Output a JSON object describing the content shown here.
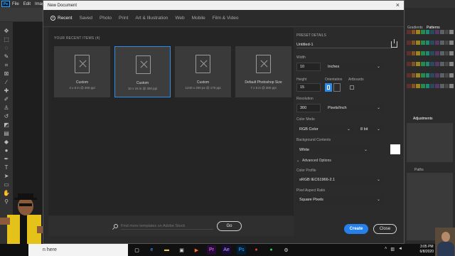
{
  "app": {
    "menu": [
      "File",
      "Edit",
      "Image"
    ],
    "logo": "Ps"
  },
  "right_panel": {
    "tabs": [
      "Gradients",
      "Patterns"
    ],
    "adjustments_label": "Adjustments",
    "layers_label": "Paths"
  },
  "dialog": {
    "title": "New Document",
    "close_glyph": "×",
    "tabs": [
      "Recent",
      "Saved",
      "Photo",
      "Print",
      "Art & Illustration",
      "Web",
      "Mobile",
      "Film & Video"
    ],
    "recent_header": "YOUR RECENT ITEMS  (4)",
    "recent_items": [
      {
        "name": "Custom",
        "desc": "4 x 6 in @ 300 ppi",
        "selected": false
      },
      {
        "name": "Custom",
        "desc": "10 x 15 in @ 300 ppi",
        "selected": true
      },
      {
        "name": "Custom",
        "desc": "1240 x 200 px @ 170 ppi",
        "selected": false
      },
      {
        "name": "Default Photoshop Size",
        "desc": "7 x 5 in @ 300 ppi",
        "selected": false
      }
    ],
    "template_search": {
      "placeholder": "Find more templates on Adobe Stock",
      "go_label": "Go"
    },
    "preset_details": {
      "header": "PRESET DETAILS",
      "name": "Untitled-1",
      "width_label": "Width",
      "width_value": "10",
      "width_unit": "Inches",
      "height_label": "Height",
      "height_value": "15",
      "orientation_label": "Orientation",
      "artboards_label": "Artboards",
      "resolution_label": "Resolution",
      "resolution_value": "300",
      "resolution_unit": "Pixels/Inch",
      "color_mode_label": "Color Mode",
      "color_mode_value": "RGB Color",
      "bit_depth": "8 bit",
      "background_label": "Background Contents",
      "background_value": "White",
      "advanced_label": "Advanced Options",
      "color_profile_label": "Color Profile",
      "color_profile_value": "sRGB IEC61966-2.1",
      "pixel_aspect_label": "Pixel Aspect Ratio",
      "pixel_aspect_value": "Square Pixels"
    },
    "create_label": "Create",
    "close_label": "Close"
  },
  "taskbar": {
    "search_text": "n here",
    "time": "3:05 PM",
    "date": "6/8/2020",
    "apps": [
      {
        "icon": "task-view-icon",
        "glyph": "▢",
        "color": "#ffffff",
        "bg": "transparent"
      },
      {
        "icon": "edge-icon",
        "glyph": "e",
        "color": "#3ba0ff",
        "bg": "transparent"
      },
      {
        "icon": "file-explorer-icon",
        "glyph": "▬",
        "color": "#f2c94c",
        "bg": "transparent"
      },
      {
        "icon": "store-icon",
        "glyph": "▣",
        "color": "#dddddd",
        "bg": "transparent"
      },
      {
        "icon": "media-player-icon",
        "glyph": "▶",
        "color": "#ff6b2b",
        "bg": "transparent"
      },
      {
        "icon": "premiere-icon",
        "glyph": "Pr",
        "color": "#e77bff",
        "bg": "#2a0a3a"
      },
      {
        "icon": "after-effects-icon",
        "glyph": "Ae",
        "color": "#b8a2ff",
        "bg": "#1a0a3a"
      },
      {
        "icon": "photoshop-icon",
        "glyph": "Ps",
        "color": "#31a8ff",
        "bg": "#001e36"
      },
      {
        "icon": "chrome-icon",
        "glyph": "●",
        "color": "#e94235",
        "bg": "transparent"
      },
      {
        "icon": "whatsapp-icon",
        "glyph": "●",
        "color": "#25d366",
        "bg": "transparent"
      },
      {
        "icon": "settings-icon",
        "glyph": "⚙",
        "color": "#dddddd",
        "bg": "transparent"
      }
    ]
  },
  "colors": {
    "accent": "#2d8ceb",
    "create_button": "#2680eb",
    "dialog_bg": "#2b2b2b",
    "background_swatch": "#ffffff"
  }
}
